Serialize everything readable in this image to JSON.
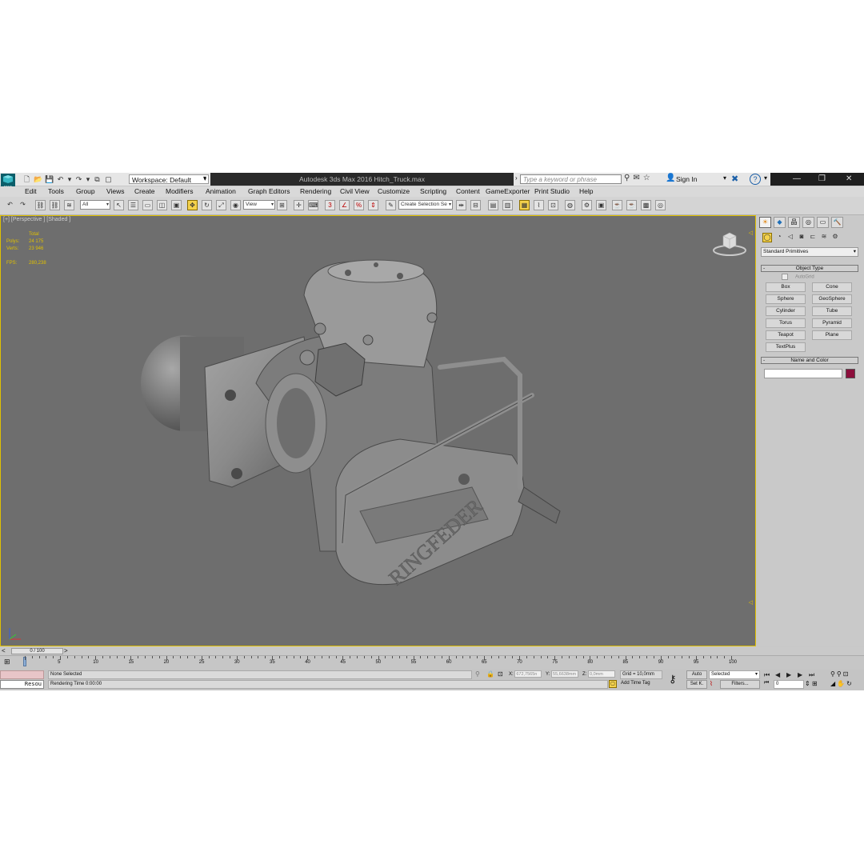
{
  "app": {
    "window_title": "Autodesk 3ds Max 2016    Hitch_Truck.max",
    "workspace_label": "Workspace: Default",
    "search_placeholder": "Type a keyword or phrase",
    "sign_in": "Sign In",
    "logo_text": "MAX"
  },
  "menu": [
    "Edit",
    "Tools",
    "Group",
    "Views",
    "Create",
    "Modifiers",
    "Animation",
    "Graph Editors",
    "Rendering",
    "Civil View",
    "Customize",
    "Scripting",
    "Content",
    "GameExporter",
    "Print Studio",
    "Help"
  ],
  "toolbar": {
    "filter_value": "All",
    "ref_coord_value": "View",
    "selection_set_placeholder": "Create Selection Se"
  },
  "viewport": {
    "label": "[+] [Perspective ] [Shaded ]",
    "stats": [
      {
        "key": "",
        "value": "Total"
      },
      {
        "key": "Polys:",
        "value": "24 175"
      },
      {
        "key": "Verts:",
        "value": "23 946"
      },
      {
        "key": "",
        "value": ""
      },
      {
        "key": "FPS:",
        "value": "280,238"
      }
    ],
    "model_text": "RINGFEDER",
    "bg_color": "#6e6e6e",
    "border_color": "#e0c000"
  },
  "command_panel": {
    "category": "Standard Primitives",
    "object_type_title": "Object Type",
    "autogrid_label": "AutoGrid",
    "buttons": [
      "Box",
      "Cone",
      "Sphere",
      "GeoSphere",
      "Cylinder",
      "Tube",
      "Torus",
      "Pyramid",
      "Teapot",
      "Plane",
      "TextPlus"
    ],
    "name_color_title": "Name and Color",
    "color_swatch": "#8c0f3c"
  },
  "timeline": {
    "slider_label": "0 / 100",
    "ticks": [
      "0",
      "5",
      "10",
      "15",
      "20",
      "25",
      "30",
      "35",
      "40",
      "45",
      "50",
      "55",
      "60",
      "65",
      "70",
      "75",
      "80",
      "85",
      "90",
      "95",
      "100"
    ]
  },
  "status": {
    "resource_label": "Resou",
    "selection_text": "None Selected",
    "prompt_text": "Rendering Time  0:00:00",
    "x_label": "X:",
    "x_value": "672,7565n",
    "y_label": "Y:",
    "y_value": "55,6638mm",
    "z_label": "Z:",
    "z_value": "0,0mm",
    "grid_text": "Grid = 10,0mm",
    "add_time_tag": "Add Time Tag",
    "auto_label": "Auto",
    "setk_label": "Set K.",
    "selected_value": "Selected",
    "filters_label": "Filters...",
    "frame_value": "0"
  }
}
